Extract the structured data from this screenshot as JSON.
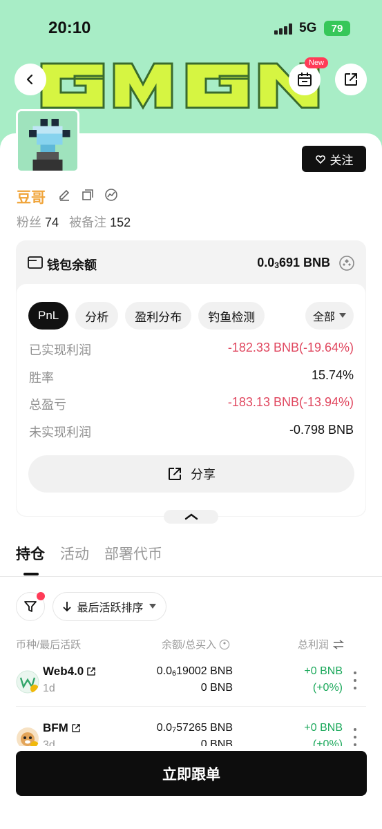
{
  "status_bar": {
    "time": "20:10",
    "network": "5G",
    "battery": "79"
  },
  "header": {
    "banner_text": "GMGN",
    "new_badge": "New"
  },
  "profile": {
    "follow_label": "关注",
    "username": "豆哥",
    "fans_label": "粉丝",
    "fans_count": "74",
    "noted_label": "被备注",
    "noted_count": "152"
  },
  "wallet": {
    "title": "钱包余额",
    "amount_prefix": "0.0",
    "amount_sub": "3",
    "amount_suffix": "691 BNB"
  },
  "pnl": {
    "tabs": [
      "PnL",
      "分析",
      "盈利分布",
      "钓鱼检测"
    ],
    "filter_all": "全部",
    "rows": [
      {
        "label": "已实现利润",
        "value": "-182.33 BNB(-19.64%)",
        "negative": true
      },
      {
        "label": "胜率",
        "value": "15.74%",
        "negative": false
      },
      {
        "label": "总盈亏",
        "value": "-183.13 BNB(-13.94%)",
        "negative": true
      },
      {
        "label": "未实现利润",
        "value": "-0.798 BNB",
        "negative": false
      }
    ],
    "share_label": "分享"
  },
  "main_tabs": [
    "持仓",
    "活动",
    "部署代币"
  ],
  "sort": {
    "label": "最后活跃排序"
  },
  "list_header": {
    "col1": "币种/最后活跃",
    "col2": "余额/总买入",
    "col3": "总利润"
  },
  "holdings": [
    {
      "name": "Web4.0",
      "time": "1d",
      "bal_prefix": "0.0",
      "bal_sub": "6",
      "bal_suffix": "19002 BNB",
      "bought": "0 BNB",
      "pnl": "+0 BNB",
      "pnl_pct": "(+0%)"
    },
    {
      "name": "BFM",
      "time": "3d",
      "bal_prefix": "0.0",
      "bal_sub": "7",
      "bal_suffix": "57265 BNB",
      "bought": "0 BNB",
      "pnl": "+0 BNB",
      "pnl_pct": "(+0%)"
    }
  ],
  "cta": {
    "label": "立即跟单"
  },
  "colors": {
    "hero_bg": "#a8edc6",
    "accent_lime": "#d6f542",
    "negative": "#e0475f",
    "positive": "#1aa85a",
    "username": "#f0a43a"
  }
}
